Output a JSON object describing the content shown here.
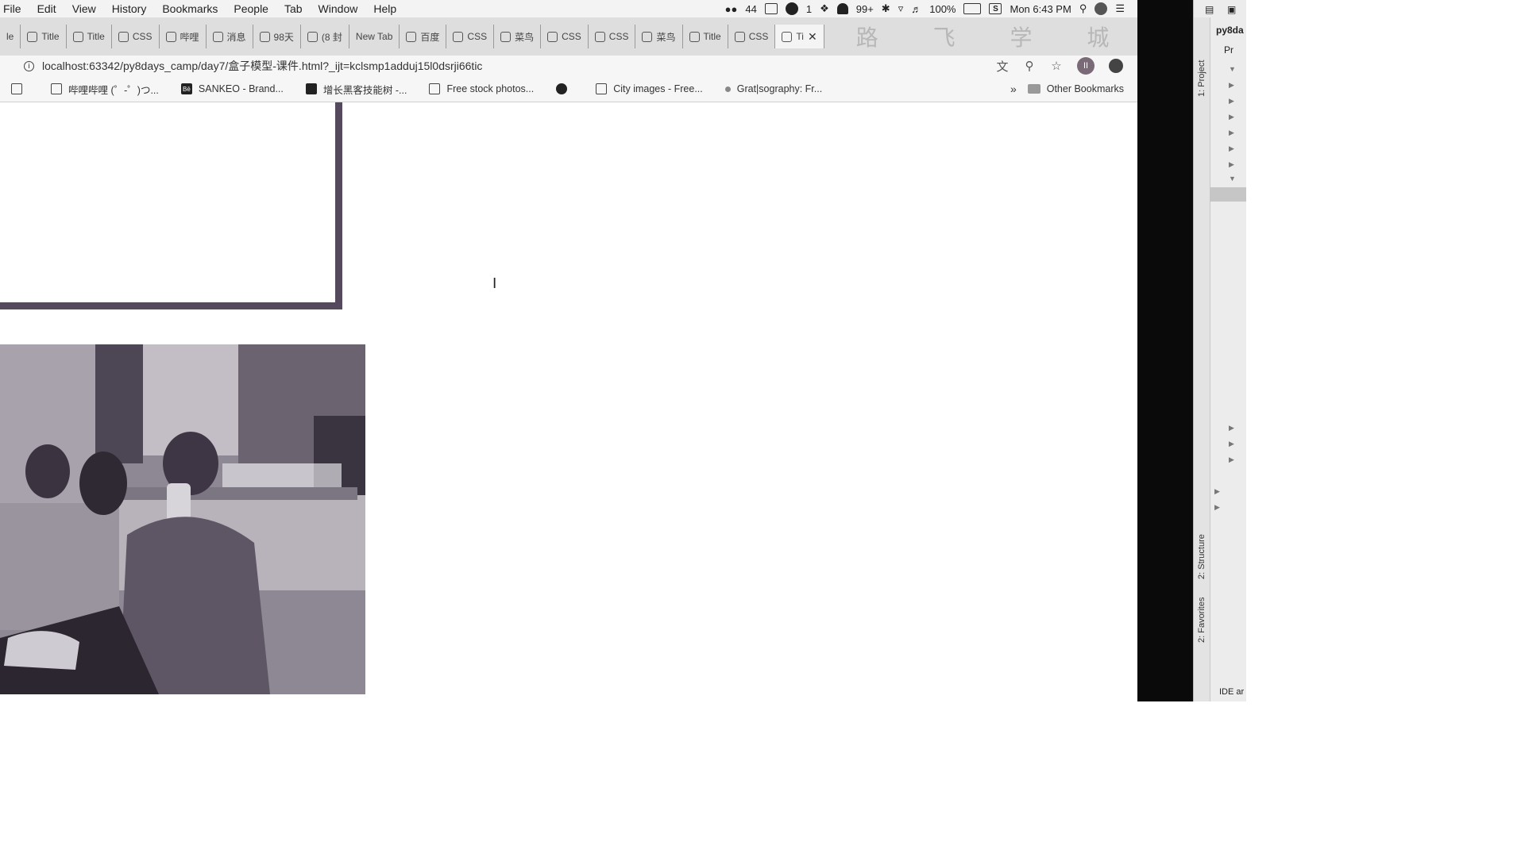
{
  "menubar": {
    "items": [
      "File",
      "Edit",
      "View",
      "History",
      "Bookmarks",
      "People",
      "Tab",
      "Window",
      "Help"
    ],
    "wechat_count": "44",
    "notify_count": "1",
    "qq_count": "99+",
    "battery": "100%",
    "clock": "Mon 6:43 PM"
  },
  "tabs": [
    {
      "label": "le",
      "active": false
    },
    {
      "label": "Title",
      "active": false
    },
    {
      "label": "Title",
      "active": false
    },
    {
      "label": "CSS",
      "active": false
    },
    {
      "label": "哔哩",
      "active": false
    },
    {
      "label": "消息",
      "active": false
    },
    {
      "label": "98天",
      "active": false
    },
    {
      "label": "(8 封",
      "active": false
    },
    {
      "label": "New Tab",
      "active": false
    },
    {
      "label": "百度",
      "active": false
    },
    {
      "label": "CSS",
      "active": false
    },
    {
      "label": "菜鸟",
      "active": false
    },
    {
      "label": "CSS",
      "active": false
    },
    {
      "label": "CSS",
      "active": false
    },
    {
      "label": "菜鸟",
      "active": false
    },
    {
      "label": "Title",
      "active": false
    },
    {
      "label": "CSS",
      "active": false
    },
    {
      "label": "Ti",
      "active": true
    }
  ],
  "watermark": "路 飞 学 城",
  "address": {
    "url": "localhost:63342/py8days_camp/day7/盒子模型-课件.html?_ijt=kclsmp1adduj15l0dsrji66tic"
  },
  "bookmarks": {
    "items": [
      {
        "label": "",
        "icon": "bilibili-icon"
      },
      {
        "label": "哔哩哔哩 (゜-゜)つ...",
        "icon": "tv-icon"
      },
      {
        "label": "SANKEO - Brand...",
        "icon": "behance-icon"
      },
      {
        "label": "增长黑客技能树 -...",
        "icon": "cube-icon"
      },
      {
        "label": "Free stock photos...",
        "icon": "photo-icon"
      },
      {
        "label": "",
        "icon": "globe-icon"
      },
      {
        "label": "City images - Free...",
        "icon": "camera-icon"
      },
      {
        "label": "Grat|sography: Fr...",
        "icon": "dot-icon"
      }
    ],
    "more": "»",
    "other": "Other Bookmarks"
  },
  "page": {
    "photo_alt": "Person drinking from a can at a cafe counter"
  },
  "ide": {
    "project_name": "py8da",
    "project_root": "Pr",
    "project_tab": "1: Project",
    "structure_tab": "2: Structure",
    "favorites_tab": "2: Favorites",
    "status": "IDE ar"
  }
}
